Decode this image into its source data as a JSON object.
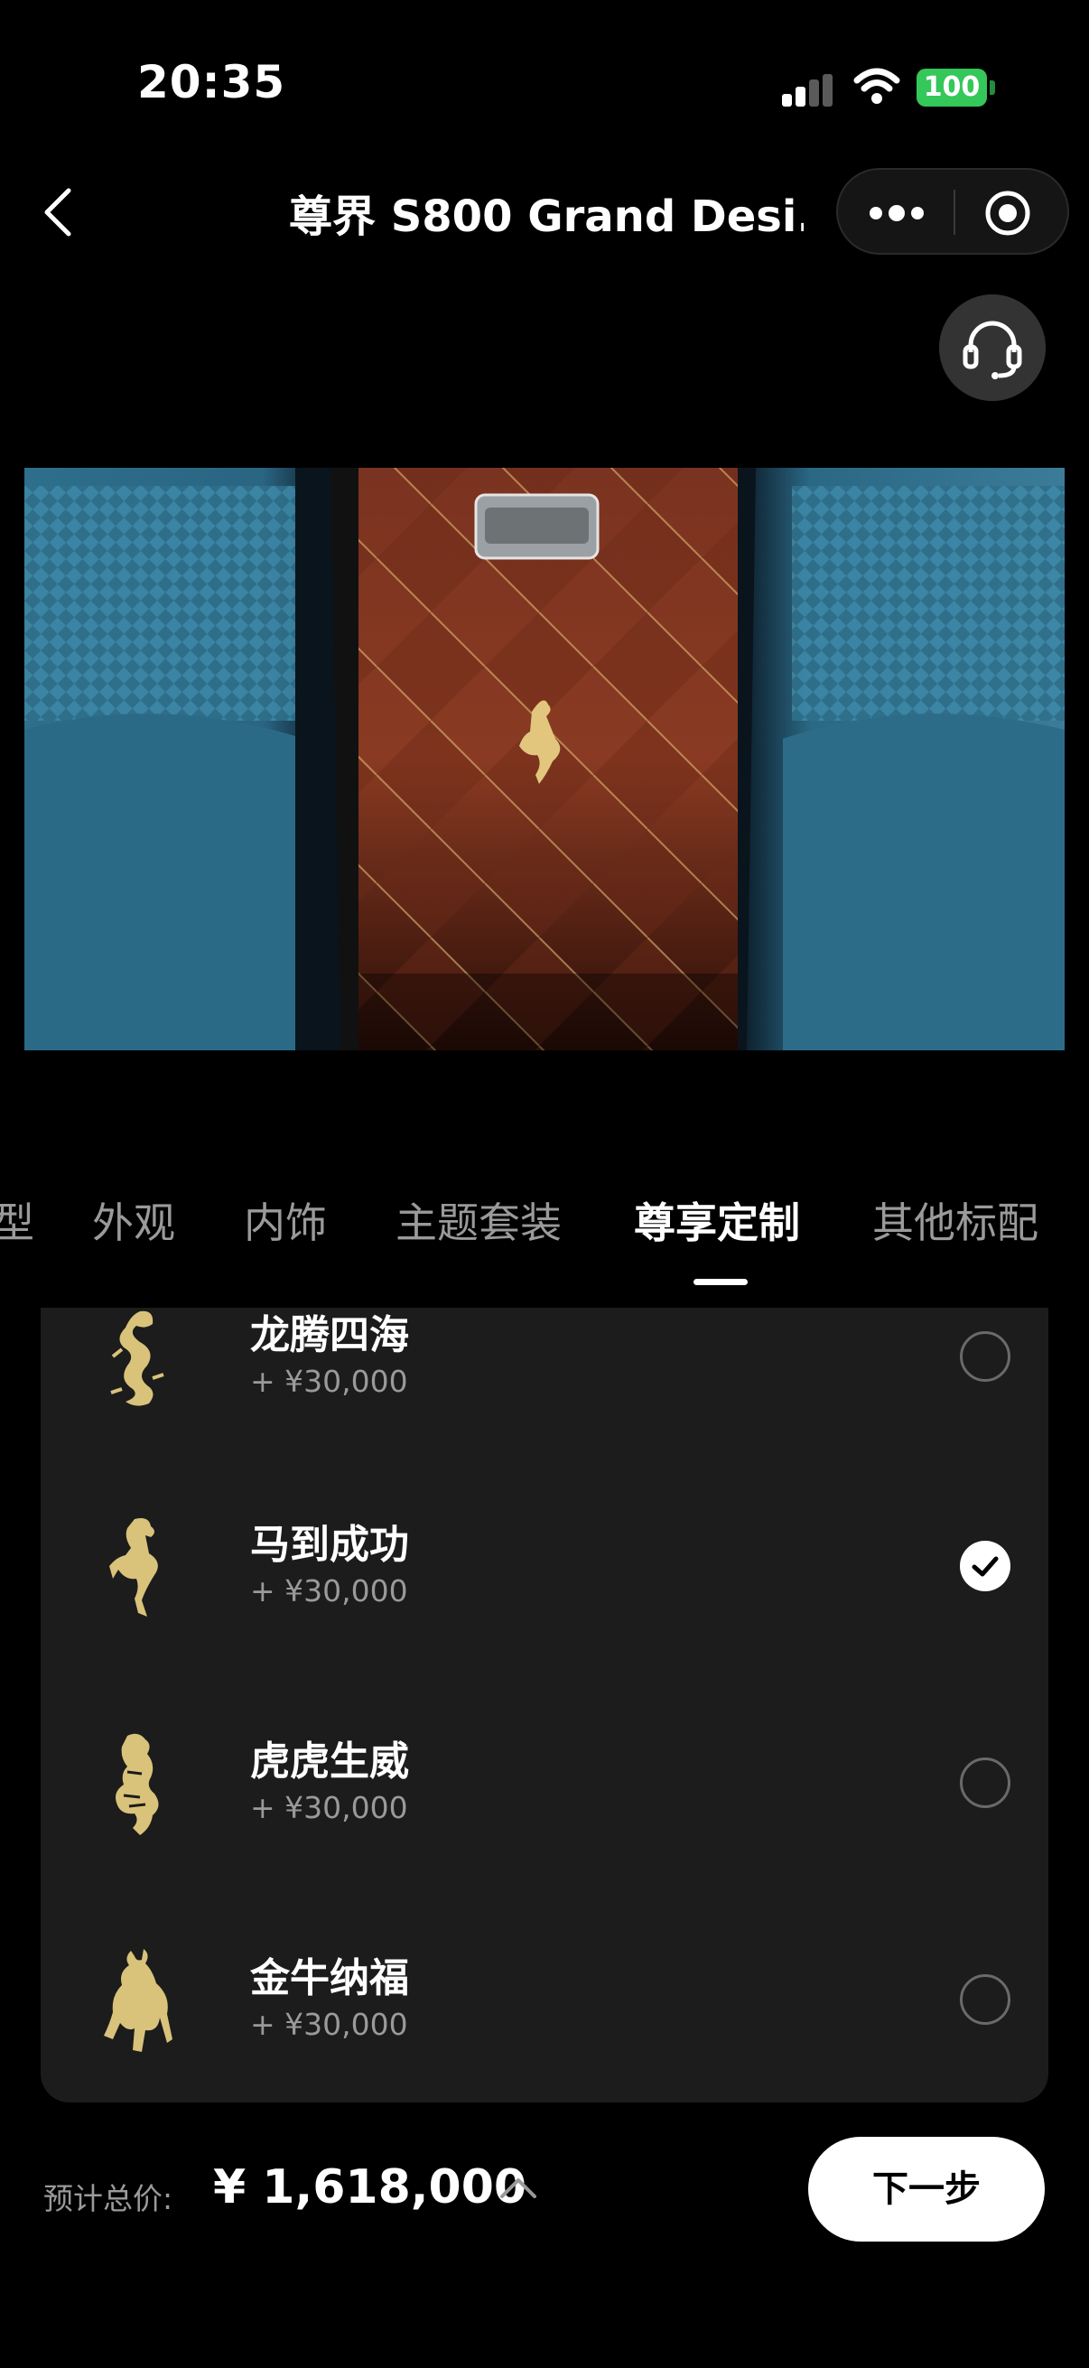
{
  "status_bar": {
    "time": "20:35",
    "battery": "100",
    "battery_color": "#34c759"
  },
  "nav": {
    "title": "尊界 S800 Grand Desi..."
  },
  "icons": {
    "back": "chevron-left-icon",
    "more": "more-dots-icon",
    "close_target": "target-icon",
    "support": "headset-icon",
    "collapse": "chevron-up-icon",
    "check": "checkmark-icon"
  },
  "tabs": [
    {
      "label": "型",
      "active": false
    },
    {
      "label": "外观",
      "active": false
    },
    {
      "label": "内饰",
      "active": false
    },
    {
      "label": "主题套装",
      "active": false
    },
    {
      "label": "尊享定制",
      "active": true
    },
    {
      "label": "其他标配",
      "active": false
    }
  ],
  "options": [
    {
      "name": "龙腾四海",
      "price": "+ ¥30,000",
      "selected": false,
      "emblem": "dragon-emblem-icon"
    },
    {
      "name": "马到成功",
      "price": "+ ¥30,000",
      "selected": true,
      "emblem": "horse-emblem-icon"
    },
    {
      "name": "虎虎生威",
      "price": "+ ¥30,000",
      "selected": false,
      "emblem": "tiger-emblem-icon"
    },
    {
      "name": "金牛纳福",
      "price": "+ ¥30,000",
      "selected": false,
      "emblem": "bull-emblem-icon"
    }
  ],
  "footer": {
    "estimate_label": "预计总价:",
    "total": "¥ 1,618,000",
    "next_label": "下一步"
  },
  "colors": {
    "gold": "#d9c27a",
    "panel": "#1c1c1c",
    "accent_text": "#ffffff"
  }
}
